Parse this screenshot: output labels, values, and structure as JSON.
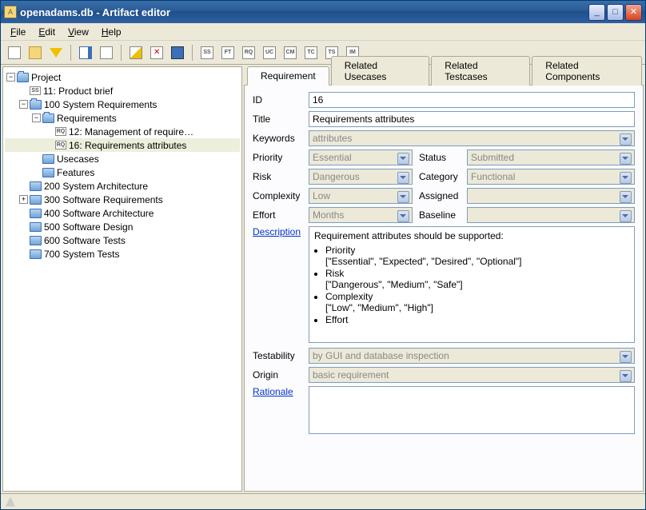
{
  "titlebar": {
    "title": "openadams.db - Artifact editor"
  },
  "menu": {
    "file": "File",
    "edit": "Edit",
    "view": "View",
    "help": "Help"
  },
  "toolbar_badges": {
    "ss": "SS",
    "ft": "FT",
    "rq": "RQ",
    "uc": "UC",
    "cm": "CM",
    "tc": "TC",
    "ts": "TS",
    "im": "IM"
  },
  "tree": {
    "root": "Project",
    "n1": "11: Product brief",
    "n2": "100 System Requirements",
    "n2a": "Requirements",
    "n2a1": "12: Management of require…",
    "n2a2": "16: Requirements attributes",
    "n2b": "Usecases",
    "n2c": "Features",
    "n3": "200 System Architecture",
    "n4": "300 Software Requirements",
    "n5": "400 Software Architecture",
    "n6": "500 Software Design",
    "n7": "600 Software Tests",
    "n8": "700 System Tests"
  },
  "tabs": {
    "requirement": "Requirement",
    "related_usecases": "Related Usecases",
    "related_testcases": "Related Testcases",
    "related_components": "Related Components"
  },
  "labels": {
    "id": "ID",
    "title": "Title",
    "keywords": "Keywords",
    "priority": "Priority",
    "status": "Status",
    "risk": "Risk",
    "category": "Category",
    "complexity": "Complexity",
    "assigned": "Assigned",
    "effort": "Effort",
    "baseline": "Baseline",
    "description": "Description",
    "testability": "Testability",
    "origin": "Origin",
    "rationale": "Rationale"
  },
  "values": {
    "id": "16",
    "title": "Requirements attributes",
    "keywords": "attributes",
    "priority": "Essential",
    "status": "Submitted",
    "risk": "Dangerous",
    "category": "Functional",
    "complexity": "Low",
    "assigned": "",
    "effort": "Months",
    "baseline": "",
    "testability": "by GUI and database inspection",
    "origin": "basic requirement",
    "description_lead": "Requirement attributes should be supported:",
    "desc_priority": "Priority",
    "desc_priority_vals": "[\"Essential\", \"Expected\", \"Desired\", \"Optional\"]",
    "desc_risk": "Risk",
    "desc_risk_vals": "[\"Dangerous\", \"Medium\", \"Safe\"]",
    "desc_complexity": "Complexity",
    "desc_complexity_vals": "[\"Low\", \"Medium\", \"High\"]",
    "desc_effort": "Effort"
  }
}
